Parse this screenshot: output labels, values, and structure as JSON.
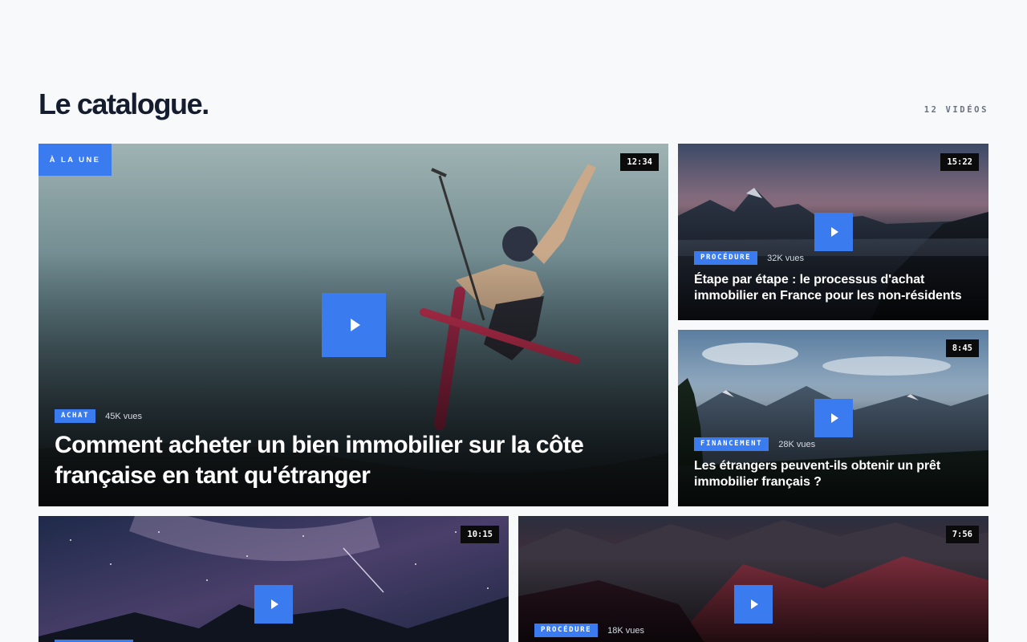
{
  "catalogue": {
    "title": "Le catalogue.",
    "count_label": "12 VIDÉOS"
  },
  "featured": {
    "badge": "À LA UNE",
    "duration": "12:34",
    "category": "ACHAT",
    "views": "45K vues",
    "title": "Comment acheter un bien immobilier sur la côte française en tant qu'étranger"
  },
  "videos": [
    {
      "duration": "15:22",
      "category": "PROCÉDURE",
      "views": "32K vues",
      "title": "Étape par étape : le processus d'achat immobilier en France pour les non-résidents"
    },
    {
      "duration": "8:45",
      "category": "FINANCEMENT",
      "views": "28K vues",
      "title": "Les étrangers peuvent-ils obtenir un prêt immobilier français ?"
    },
    {
      "duration": "10:15",
      "category": "",
      "views": "",
      "title": ""
    },
    {
      "duration": "7:56",
      "category": "PROCÉDURE",
      "views": "18K vues",
      "title": ""
    }
  ],
  "colors": {
    "accent": "#3b7bf0",
    "background": "#f7f9fb",
    "title": "#141c2e"
  },
  "icons": [
    "play-icon"
  ]
}
